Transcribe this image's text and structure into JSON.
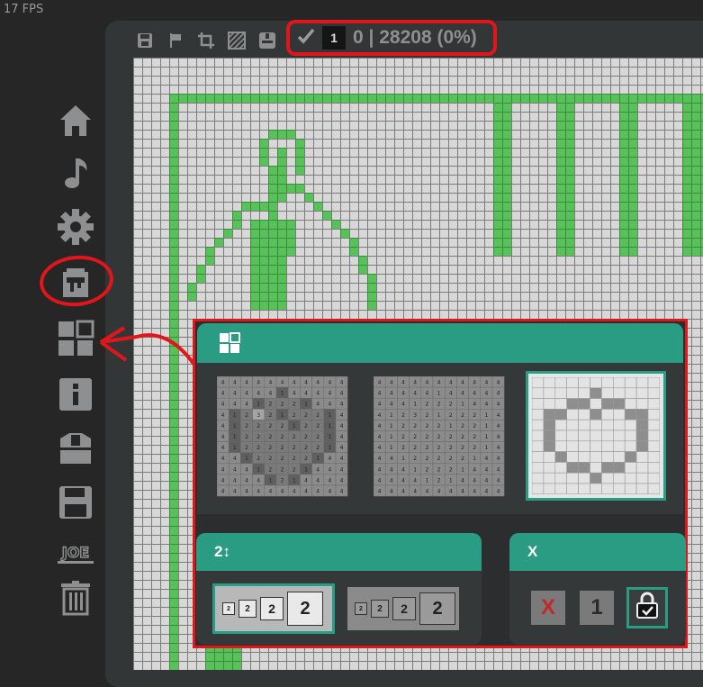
{
  "fps_label": "17 FPS",
  "toolbar": {
    "icons": [
      "save-icon",
      "flag-icon",
      "crop-icon",
      "hatch-pattern-icon",
      "toggle-icon"
    ],
    "check_icon": "check-icon",
    "counter_value": "1",
    "status_text": "0 | 28208 (0%)"
  },
  "sidebar": {
    "items": [
      "home-icon",
      "music-note-icon",
      "gear-icon",
      "paint-bucket-icon",
      "grid-layout-icon",
      "info-icon",
      "tshirt-icon",
      "floppy-disk-icon",
      "joe-logo-icon",
      "trash-icon"
    ],
    "logo_text": "JOE"
  },
  "modal": {
    "header_icon": "grid-layout-icon",
    "size_panel": {
      "title": "2↕",
      "options": [
        "2",
        "2",
        "2",
        "2"
      ]
    },
    "x_panel": {
      "title": "X",
      "x_label": "X",
      "one_label": "1"
    }
  },
  "colors": {
    "accent": "#2a9c83",
    "pixel_green": "#58c15a",
    "annotation_red": "#e0161b"
  }
}
